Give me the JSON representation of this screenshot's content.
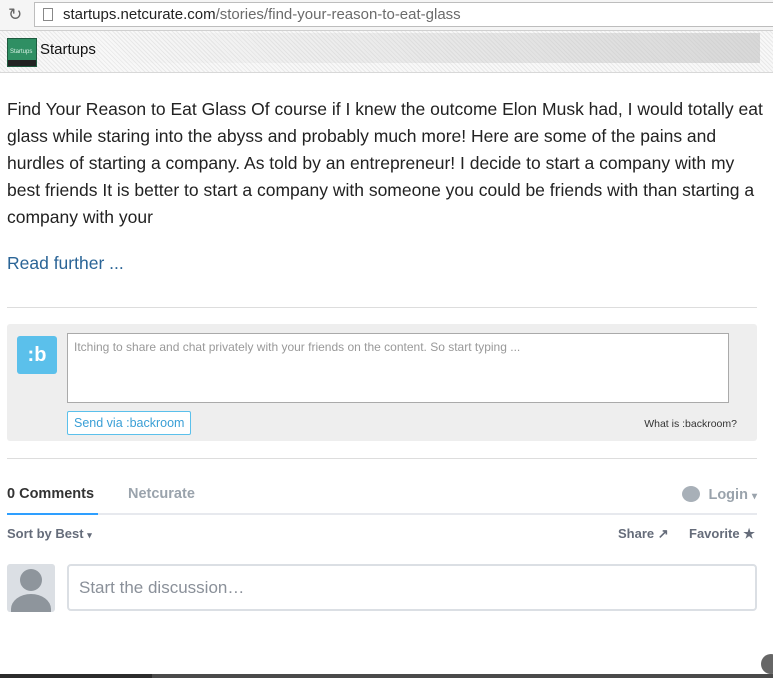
{
  "browser": {
    "url_domain": "startups.netcurate.com",
    "url_path": "/stories/find-your-reason-to-eat-glass"
  },
  "header": {
    "brand": "Startups",
    "logo_text": "Startups"
  },
  "article": {
    "text": "Find Your Reason to Eat Glass Of course if I knew the outcome Elon Musk had, I would totally eat glass while staring into the abyss and probably much more! Here are some of the pains and hurdles of starting a company. As told by an entrepreneur! I decide to start a company with my best friends It is better to start a company with someone you could be friends with than starting a company with your",
    "read_more": "Read further ..."
  },
  "backroom": {
    "icon_glyph": ":b",
    "placeholder": "Itching to share and chat privately with your friends on the content. So start typing ...",
    "send_label": "Send via :backroom",
    "what_label": "What is :backroom?"
  },
  "comments": {
    "count_tab": "0 Comments",
    "site_tab": "Netcurate",
    "login_label": "Login",
    "sort_label": "Sort by Best",
    "share_label": "Share",
    "favorite_label": "Favorite",
    "discussion_placeholder": "Start the discussion…"
  },
  "icons": {
    "reload": "reload-icon",
    "page": "page-icon",
    "login_bubble": "chat-bubble-icon",
    "share": "share-icon",
    "favorite": "star-icon"
  },
  "colors": {
    "link": "#2a6496",
    "accent": "#2e9fff",
    "backroom": "#5bc0eb"
  }
}
